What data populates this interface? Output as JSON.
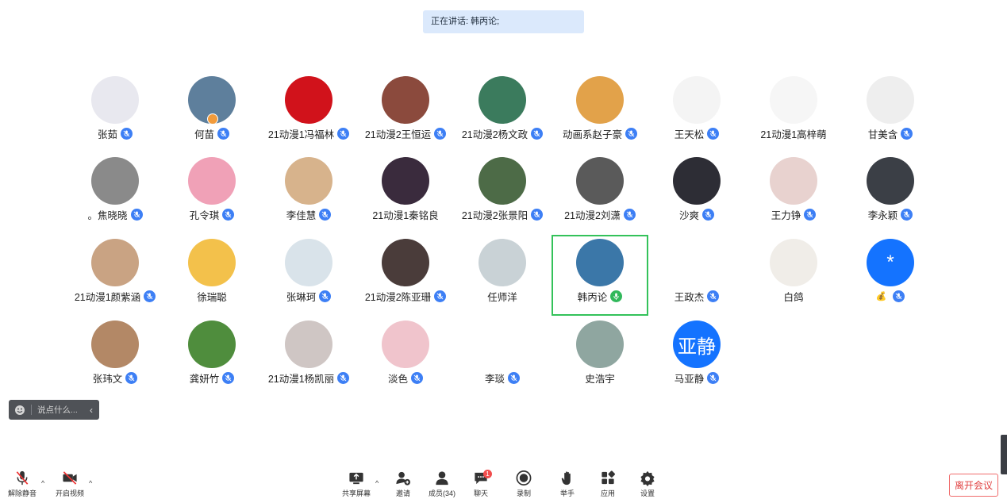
{
  "banner": {
    "text": "正在讲话: 韩丙论;"
  },
  "participants": [
    {
      "name": "张茹",
      "bg": "#e8e8ef",
      "mic": "muted"
    },
    {
      "name": "何苗",
      "bg": "#5e7f9c",
      "mic": "muted"
    },
    {
      "name": "21动漫1冯福林",
      "bg": "#d1121b",
      "mic": "muted"
    },
    {
      "name": "21动漫2王恒运",
      "bg": "#8b4a3d",
      "mic": "muted"
    },
    {
      "name": "21动漫2杨文政",
      "bg": "#3b7b5d",
      "mic": "muted"
    },
    {
      "name": "动画系赵子豪",
      "bg": "#e2a24a",
      "mic": "muted"
    },
    {
      "name": "王天松",
      "bg": "#f4f4f4",
      "mic": "muted"
    },
    {
      "name": "21动漫1高梓萌",
      "bg": "#f6f6f6",
      "mic": "none"
    },
    {
      "name": "甘美含",
      "bg": "#eeeeee",
      "mic": "muted"
    },
    {
      "name": "。焦晓晓",
      "bg": "#8a8a8a",
      "mic": "muted"
    },
    {
      "name": "孔令琪",
      "bg": "#f0a1b7",
      "mic": "muted"
    },
    {
      "name": "李佳慧",
      "bg": "#d7b38c",
      "mic": "muted"
    },
    {
      "name": "21动漫1秦铭良",
      "bg": "#3a2b3d",
      "mic": "none"
    },
    {
      "name": "21动漫2张景阳",
      "bg": "#4d6b47",
      "mic": "muted"
    },
    {
      "name": "21动漫2刘潇",
      "bg": "#5a5a5a",
      "mic": "muted"
    },
    {
      "name": "沙爽",
      "bg": "#2d2d35",
      "mic": "muted"
    },
    {
      "name": "王力铮",
      "bg": "#e8d2cf",
      "mic": "muted"
    },
    {
      "name": "李永颖",
      "bg": "#3b3f46",
      "mic": "muted"
    },
    {
      "name": "21动漫1颜紫涵",
      "bg": "#c9a383",
      "mic": "muted"
    },
    {
      "name": "徐瑞聪",
      "bg": "#f3c14b",
      "mic": "none"
    },
    {
      "name": "张琳珂",
      "bg": "#d9e3ea",
      "mic": "muted"
    },
    {
      "name": "21动漫2陈亚珊",
      "bg": "#4a3c3a",
      "mic": "muted"
    },
    {
      "name": "任师洋",
      "bg": "#c9d2d6",
      "mic": "none"
    },
    {
      "name": "韩丙论",
      "bg": "#3b77a8",
      "mic": "on",
      "active": true
    },
    {
      "name": "王政杰",
      "bg": "#ffffff",
      "mic": "muted"
    },
    {
      "name": "白鸽",
      "bg": "#f0ede8",
      "mic": "none"
    },
    {
      "name": "",
      "bg": "#1473ff",
      "mic": "muted",
      "initial": "*",
      "prefix": "💰"
    },
    {
      "name": "张玮文",
      "bg": "#b38866",
      "mic": "muted"
    },
    {
      "name": "龚妍竹",
      "bg": "#4f8d3d",
      "mic": "muted"
    },
    {
      "name": "21动漫1杨凯丽",
      "bg": "#cfc6c4",
      "mic": "muted"
    },
    {
      "name": "淡色",
      "bg": "#f0c4cc",
      "mic": "muted"
    },
    {
      "name": "李琰",
      "bg": "#ffffff",
      "mic": "muted"
    },
    {
      "name": "史浩宇",
      "bg": "#8fa6a0",
      "mic": "none"
    },
    {
      "name": "马亚静",
      "bg": "#1473ff",
      "mic": "muted",
      "initial": "亚静"
    }
  ],
  "chat": {
    "placeholder": "说点什么..."
  },
  "toolbar": {
    "unmute": "解除静音",
    "start_video": "开启视频",
    "share": "共享屏幕",
    "invite": "邀请",
    "members": "成员(34)",
    "chat": "聊天",
    "chat_badge": "1",
    "record": "录制",
    "raise_hand": "举手",
    "apps": "应用",
    "settings": "设置",
    "leave": "离开会议"
  }
}
